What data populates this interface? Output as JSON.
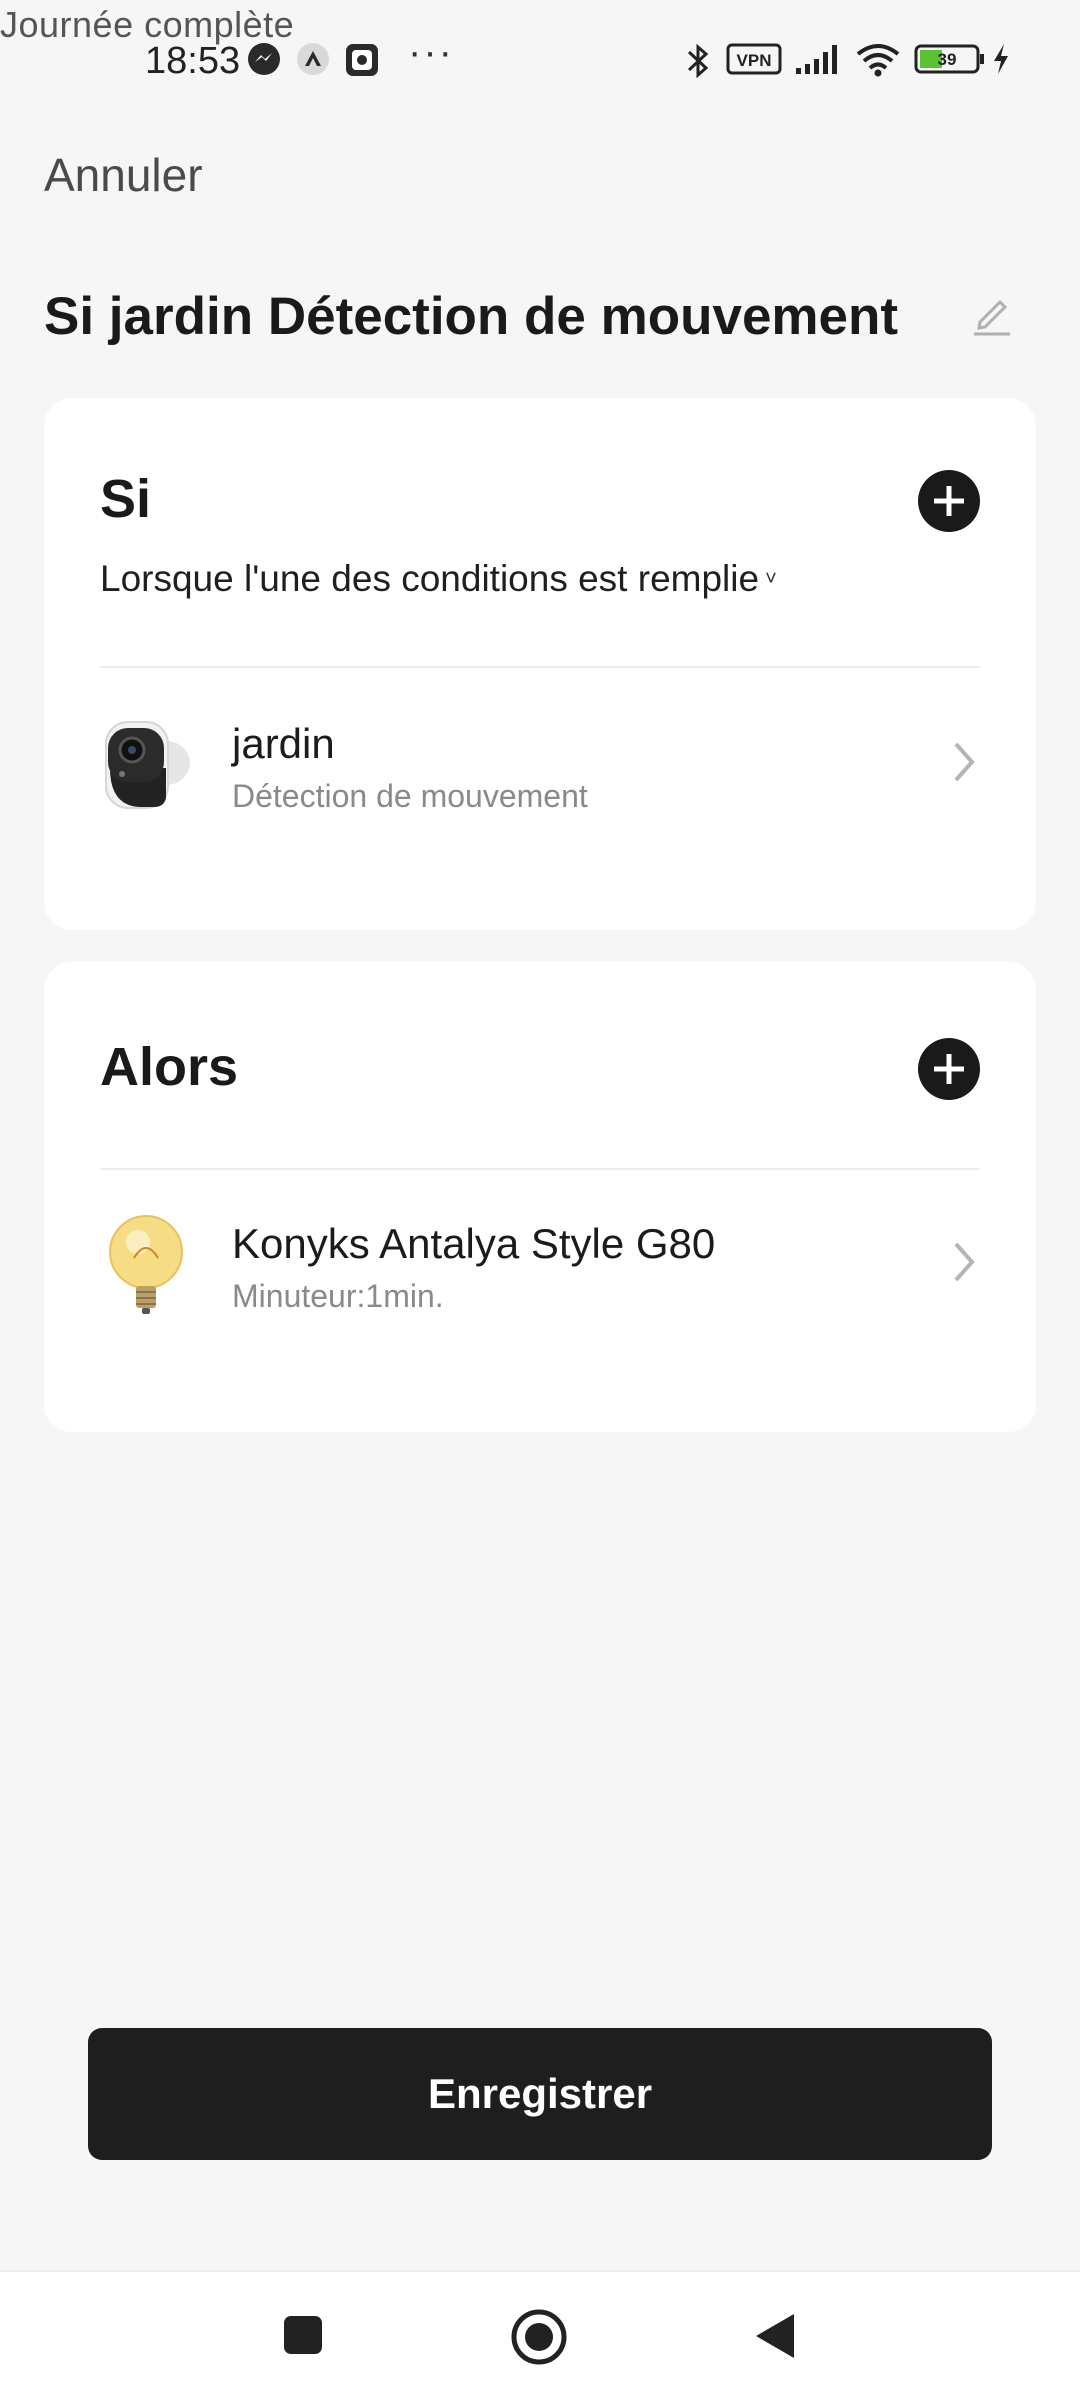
{
  "overlay": {
    "text": "Journée complète"
  },
  "status_bar": {
    "time": "18:53",
    "vpn_label": "VPN",
    "battery_level": "39",
    "icons": [
      "messenger-icon",
      "app-icon",
      "screenshot-icon",
      "more-dots-icon",
      "bluetooth-icon",
      "vpn-icon",
      "signal-icon",
      "wifi-icon",
      "battery-icon",
      "charging-icon"
    ]
  },
  "header": {
    "cancel_label": "Annuler",
    "title": "Si jardin Détection de mouvement"
  },
  "if_section": {
    "title": "Si",
    "condition_mode": "Lorsque l'une des conditions est remplie",
    "items": [
      {
        "name": "jardin",
        "detail": "Détection de mouvement",
        "icon": "camera-thumbnail"
      }
    ]
  },
  "then_section": {
    "title": "Alors",
    "items": [
      {
        "name": "Konyks Antalya Style G80",
        "detail": "Minuteur:1min.",
        "icon": "bulb-thumbnail"
      }
    ]
  },
  "footer": {
    "save_label": "Enregistrer"
  },
  "nav_bar": {
    "buttons": [
      "recents-square-icon",
      "home-circle-icon",
      "back-triangle-icon"
    ]
  }
}
